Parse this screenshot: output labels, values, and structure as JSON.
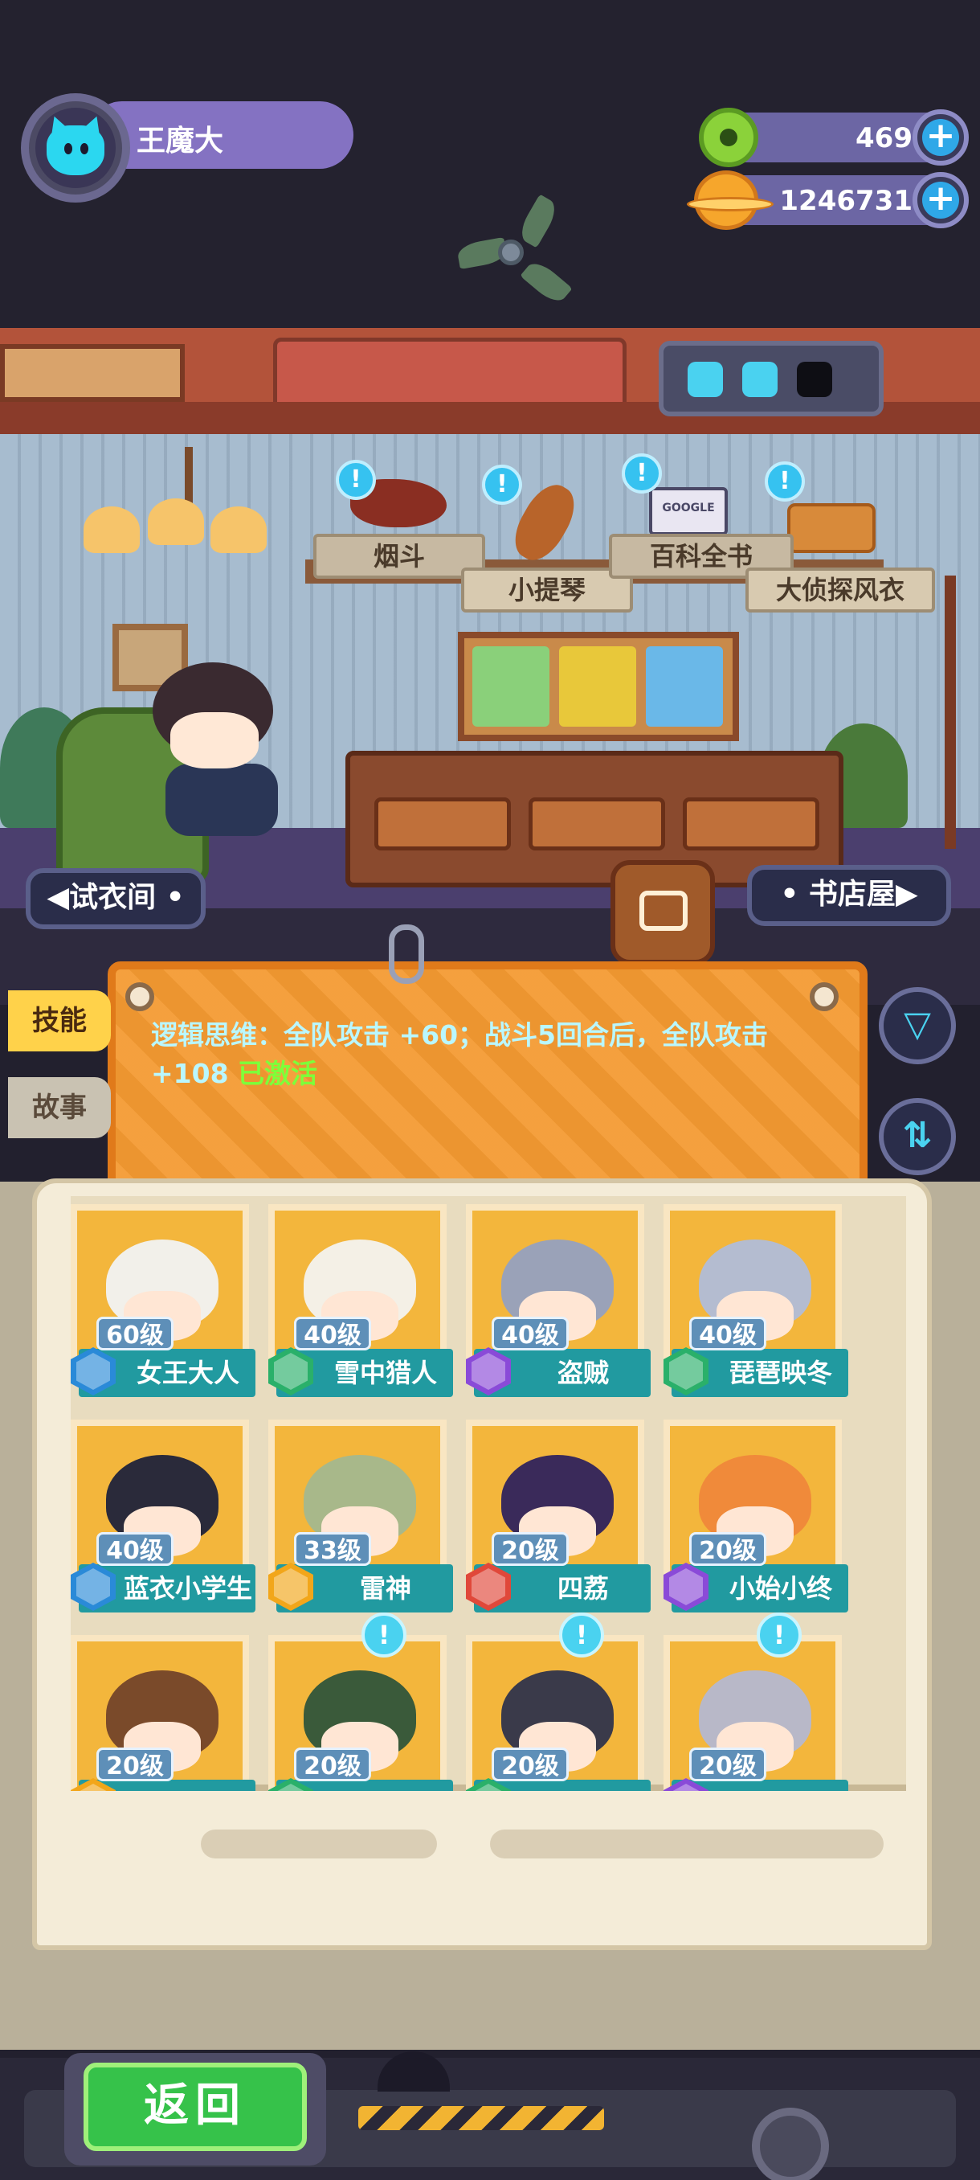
{
  "player": {
    "name": "王魔大"
  },
  "resources": [
    {
      "icon": "donut-coin-icon",
      "value": "469"
    },
    {
      "icon": "planet-gold-icon",
      "value": "1246731"
    }
  ],
  "shelf_items": [
    {
      "label": "烟斗"
    },
    {
      "label": "小提琴"
    },
    {
      "label": "百科全书"
    },
    {
      "label": "大侦探风衣"
    }
  ],
  "book_sign": "GOOGLE",
  "nav": {
    "left": "试衣间",
    "right": "书店屋"
  },
  "tabs": {
    "skill": "技能",
    "story": "故事"
  },
  "skill": {
    "description": "逻辑思维：全队攻击 +60；战斗5回合后，全队攻击 +108",
    "status": "已激活"
  },
  "characters": [
    {
      "level": "60级",
      "name": "女王大人",
      "class_color": "#2a8ad8",
      "hair": "#f2f0ea",
      "alert": false
    },
    {
      "level": "40级",
      "name": "雪中猎人",
      "class_color": "#2ab06a",
      "hair": "#f4f0e6",
      "alert": false
    },
    {
      "level": "40级",
      "name": "盗贼",
      "class_color": "#8a4ad8",
      "hair": "#9aa2b8",
      "alert": false
    },
    {
      "level": "40级",
      "name": "琵琶映冬",
      "class_color": "#2ab06a",
      "hair": "#b4bcd0",
      "alert": false
    },
    {
      "level": "40级",
      "name": "蓝衣小学生",
      "class_color": "#2a8ad8",
      "hair": "#2a2a3a",
      "alert": false
    },
    {
      "level": "33级",
      "name": "雷神",
      "class_color": "#f2a61a",
      "hair": "#a8b88a",
      "alert": false
    },
    {
      "level": "20级",
      "name": "四荔",
      "class_color": "#e0483a",
      "hair": "#3a2a5a",
      "alert": false
    },
    {
      "level": "20级",
      "name": "小始小终",
      "class_color": "#8a4ad8",
      "hair": "#f08a3a",
      "alert": false
    },
    {
      "level": "20级",
      "name": "",
      "class_color": "#f2a61a",
      "hair": "#7a4a2a",
      "alert": false
    },
    {
      "level": "20级",
      "name": "",
      "class_color": "#2ab06a",
      "hair": "#3a5a3a",
      "alert": true
    },
    {
      "level": "20级",
      "name": "",
      "class_color": "#2ab06a",
      "hair": "#3a3a4a",
      "alert": true
    },
    {
      "level": "20级",
      "name": "",
      "class_color": "#8a4ad8",
      "hair": "#b8b8c8",
      "alert": true
    }
  ],
  "alert_mark": "!",
  "back_button": "返回",
  "colors": {
    "accent": "#4ad2f0",
    "panel": "#f49a32",
    "card_bar": "#219aa0",
    "active": "#7dff3a"
  }
}
